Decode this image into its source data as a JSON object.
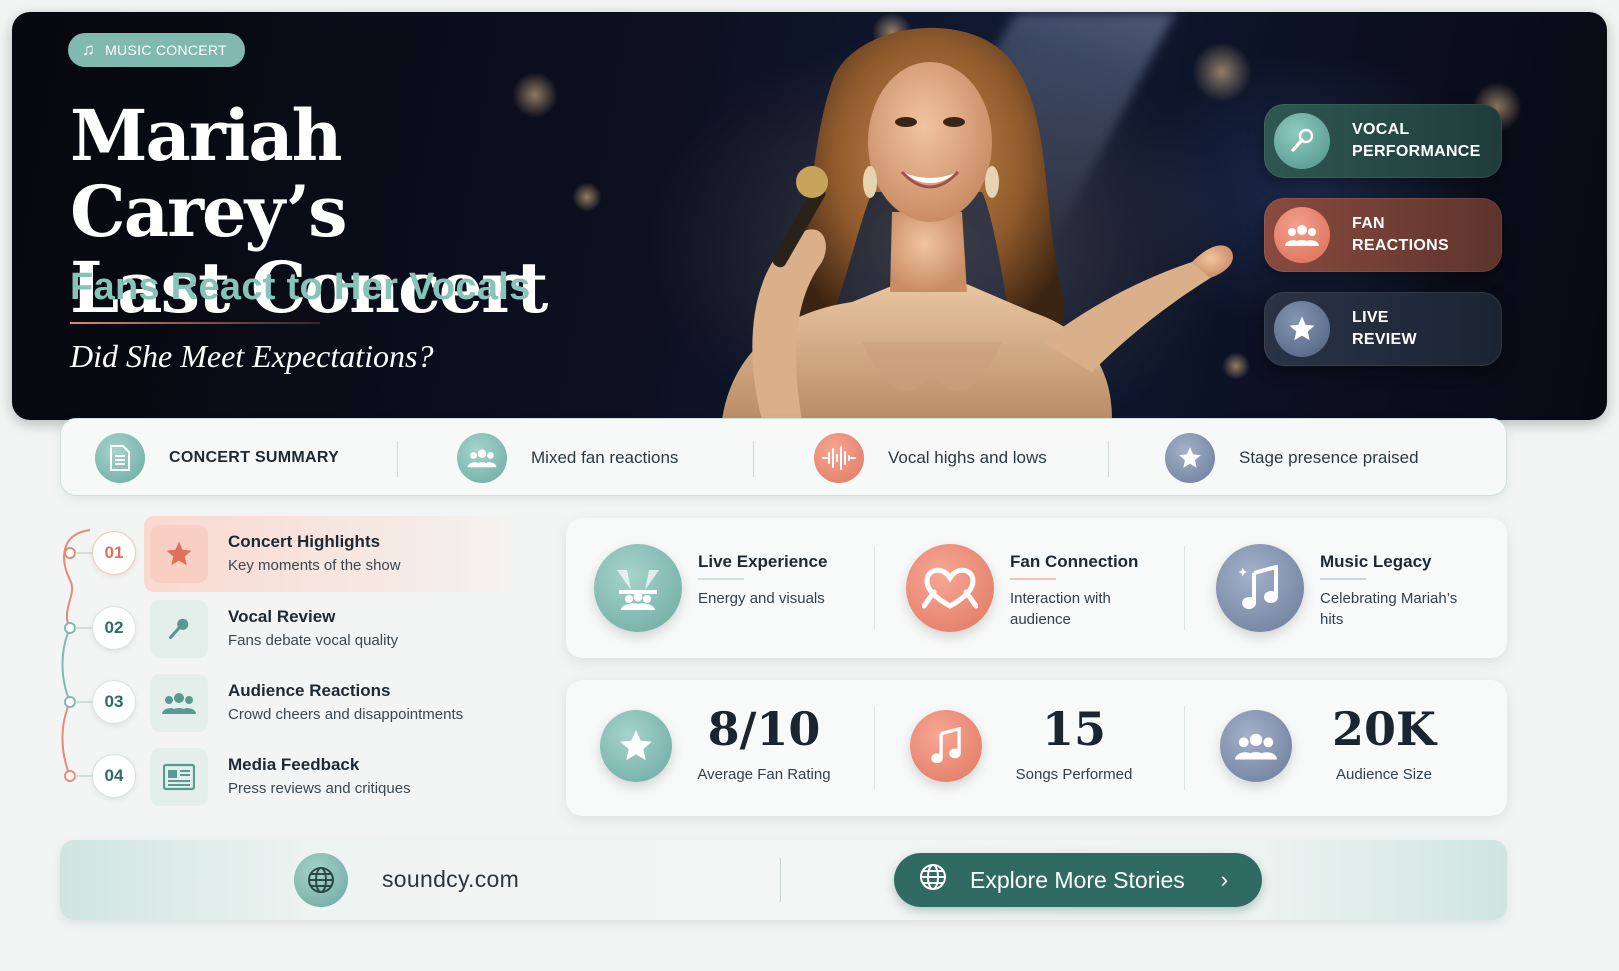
{
  "hero": {
    "tag": "MUSIC CONCERT",
    "title_line1": "Mariah Carey’s",
    "title_line2": "Last Concert",
    "subtitle": "Fans React to Her Vocals",
    "question": "Did She Meet Expectations?",
    "pills": [
      {
        "line1": "VOCAL",
        "line2": "PERFORMANCE",
        "icon": "microphone-icon"
      },
      {
        "line1": "FAN",
        "line2": "REACTIONS",
        "icon": "people-icon"
      },
      {
        "line1": "LIVE",
        "line2": "REVIEW",
        "icon": "star-icon"
      }
    ]
  },
  "summary": {
    "title": "CONCERT SUMMARY",
    "items": [
      {
        "label": "Mixed fan reactions",
        "icon": "people-icon"
      },
      {
        "label": "Vocal highs and lows",
        "icon": "soundwave-icon"
      },
      {
        "label": "Stage presence praised",
        "icon": "star-icon"
      }
    ]
  },
  "timeline": [
    {
      "num": "01",
      "title": "Concert Highlights",
      "desc": "Key moments of the show",
      "icon": "star-icon"
    },
    {
      "num": "02",
      "title": "Vocal Review",
      "desc": "Fans debate vocal quality",
      "icon": "microphone-icon"
    },
    {
      "num": "03",
      "title": "Audience Reactions",
      "desc": "Crowd cheers and disappointments",
      "icon": "crowd-icon"
    },
    {
      "num": "04",
      "title": "Media Feedback",
      "desc": "Press reviews and critiques",
      "icon": "newspaper-icon"
    }
  ],
  "cards": [
    {
      "title": "Live Experience",
      "desc": "Energy and visuals",
      "icon": "stage-icon"
    },
    {
      "title": "Fan Connection",
      "desc": "Interaction with audience",
      "icon": "heart-hands-icon"
    },
    {
      "title": "Music Legacy",
      "desc": "Celebrating Mariah’s hits",
      "icon": "music-note-icon"
    }
  ],
  "stats": [
    {
      "value": "8/10",
      "label": "Average Fan Rating",
      "icon": "star-icon"
    },
    {
      "value": "15",
      "label": "Songs Performed",
      "icon": "music-note-icon"
    },
    {
      "value": "20K",
      "label": "Audience Size",
      "icon": "people-icon"
    }
  ],
  "footer": {
    "site": "soundcy.com",
    "cta": "Explore More Stories"
  },
  "colors": {
    "teal": "#2f6b63",
    "teal_light": "#86c3b8",
    "coral": "#e0705b",
    "slate": "#6a7b99"
  }
}
